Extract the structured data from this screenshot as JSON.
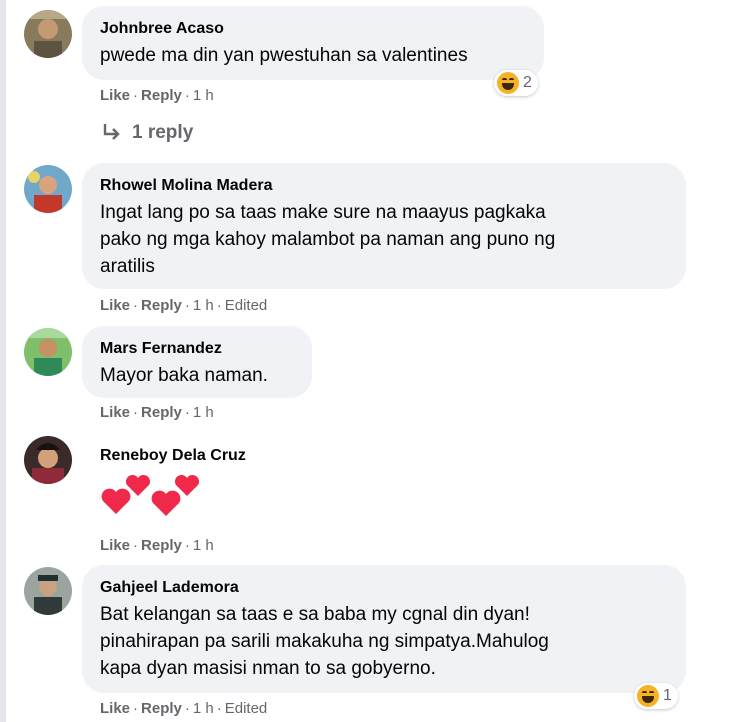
{
  "actions": {
    "like": "Like",
    "reply": "Reply",
    "dot": "·",
    "edited": "Edited"
  },
  "comments": [
    {
      "author": "Johnbree Acaso",
      "text": "pwede ma din yan pwestuhan sa valentines",
      "time": "1 h",
      "reaction": {
        "icon": "haha-icon",
        "count": "2"
      },
      "replies_label": "1 reply"
    },
    {
      "author": "Rhowel Molina Madera",
      "lines": [
        "Ingat lang po sa taas make sure na maayus pagkaka",
        "pako ng mga kahoy malambot pa naman ang puno ng",
        "aratilis"
      ],
      "time": "1 h",
      "edited": true
    },
    {
      "author": "Mars Fernandez",
      "text": "Mayor baka naman.",
      "time": "1 h"
    },
    {
      "author": "Reneboy Dela Cruz",
      "emoji": "hearts",
      "time": "1 h"
    },
    {
      "author": "Gahjeel Lademora",
      "lines": [
        "Bat kelangan sa taas e sa baba my cgnal din dyan!",
        "pinahirapan pa sarili makakuha ng simpatya.Mahulog",
        "kapa dyan masisi nman to sa gobyerno."
      ],
      "time": "1 h",
      "edited": true,
      "reaction": {
        "icon": "haha-icon",
        "count": "1"
      }
    }
  ],
  "colors": {
    "bubble": "#f0f2f5",
    "meta": "#65676b",
    "heart": "#f02849",
    "haha": "#f7b125"
  }
}
